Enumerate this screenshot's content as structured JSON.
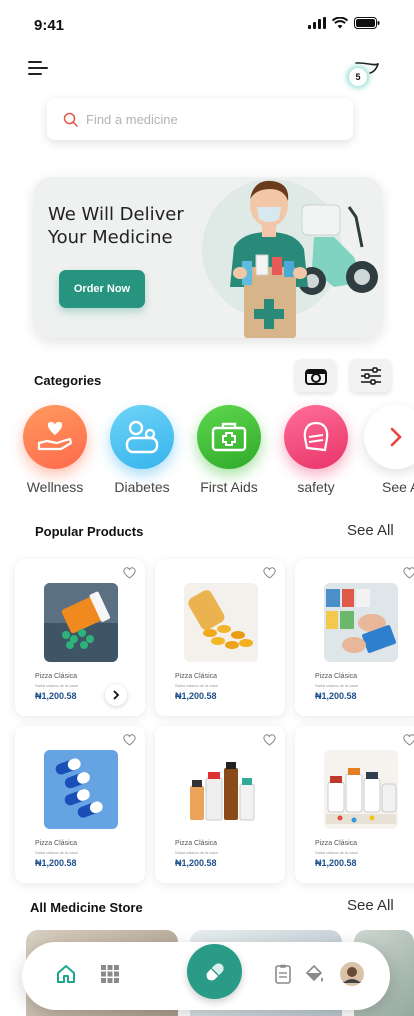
{
  "status_bar": {
    "time": "9:41"
  },
  "header": {
    "cart_count": "5"
  },
  "search": {
    "placeholder": "Find a medicine"
  },
  "banner": {
    "title_line1": "We Will Deliver",
    "title_line2": "Your Medicine",
    "button": "Order Now"
  },
  "categories": {
    "title": "Categories",
    "items": [
      {
        "label": "Wellness",
        "icon": "hand-heart-icon",
        "color": "#ff7e5a"
      },
      {
        "label": "Diabetes",
        "icon": "diabetes-icon",
        "color": "#4fc6f2"
      },
      {
        "label": "First Aids",
        "icon": "first-aid-kit-icon",
        "color": "#43c23c"
      },
      {
        "label": "safety",
        "icon": "safety-mask-icon",
        "color": "#f0507e"
      },
      {
        "label": "See All",
        "icon": "chevron-right-icon",
        "color": "#e8453c"
      }
    ]
  },
  "popular": {
    "title": "Popular Products",
    "see_all": "See All",
    "products": [
      {
        "name": "Pizza Clásica",
        "subtitle": "Salsa clásica de la casa",
        "price": "₦1,200.58",
        "image": "pill-bottle-image"
      },
      {
        "name": "Pizza Clásica",
        "subtitle": "Salsa clásica de la casa",
        "price": "₦1,200.58",
        "image": "fish-oil-capsules-image"
      },
      {
        "name": "Pizza Clásica",
        "subtitle": "Salsa clásica de la casa",
        "price": "₦1,200.58",
        "image": "pharmacy-shelf-image"
      },
      {
        "name": "Pizza Clásica",
        "subtitle": "Salsa clásica de la casa",
        "price": "₦1,200.58",
        "image": "blue-capsules-image"
      },
      {
        "name": "Pizza Clásica",
        "subtitle": "Salsa clásica de la casa",
        "price": "₦1,200.58",
        "image": "medicine-bottles-image"
      },
      {
        "name": "Pizza Clásica",
        "subtitle": "Salsa clásica de la casa",
        "price": "₦1,200.58",
        "image": "supplement-bottles-image"
      }
    ]
  },
  "stores": {
    "title": "All Medicine Store",
    "see_all": "See All"
  },
  "bottom_nav": {
    "items": [
      "home-icon",
      "grid-icon",
      "pill-icon",
      "document-icon",
      "paint-bucket-icon",
      "profile-avatar"
    ]
  }
}
